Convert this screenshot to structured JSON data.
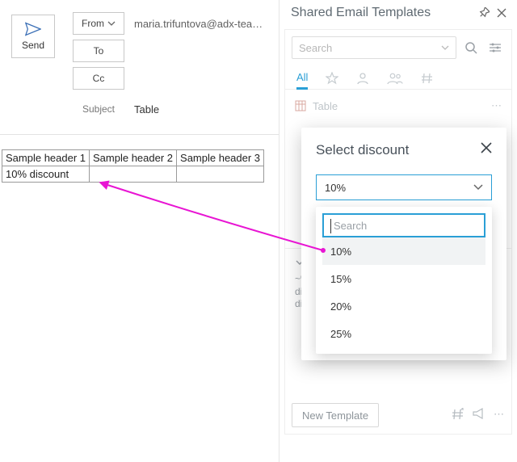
{
  "compose": {
    "send_label": "Send",
    "from_label": "From",
    "from_value": "maria.trifuntova@adx-tea…",
    "to_label": "To",
    "cc_label": "Cc",
    "subject_label": "Subject",
    "subject_value": "Table",
    "table": {
      "headers": [
        "Sample header 1",
        "Sample header 2",
        "Sample header 3"
      ],
      "rows": [
        [
          "10% discount",
          "",
          ""
        ]
      ]
    }
  },
  "panel": {
    "title": "Shared Email Templates",
    "search_placeholder": "Search",
    "tabs": {
      "all": "All"
    },
    "list_item": "Table",
    "preview_name": "Table",
    "preview_lines": [
      "~%",
      "di",
      "di"
    ],
    "new_template": "New Template"
  },
  "dialog": {
    "title": "Select discount",
    "selected": "10%",
    "search_placeholder": "Search",
    "options": [
      "10%",
      "15%",
      "20%",
      "25%"
    ]
  }
}
